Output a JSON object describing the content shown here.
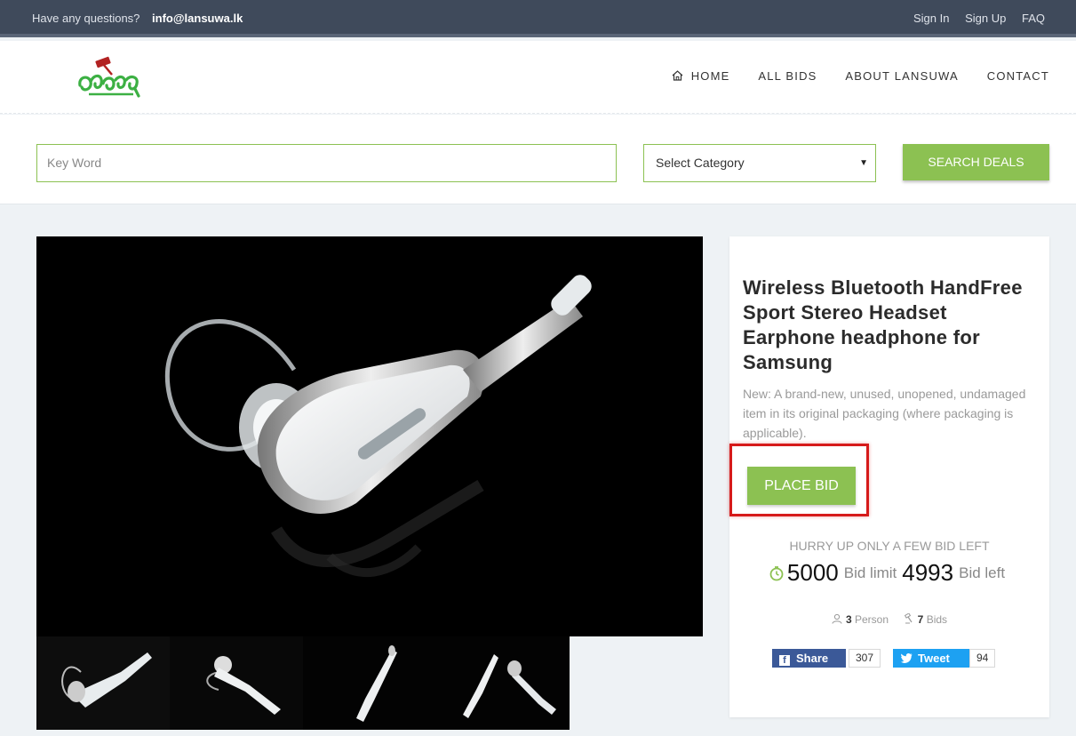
{
  "topbar": {
    "question": "Have any questions?",
    "email": "info@lansuwa.lk",
    "links": [
      "Sign In",
      "Sign Up",
      "FAQ"
    ]
  },
  "header": {
    "nav": {
      "home": "HOME",
      "all_bids": "ALL BIDS",
      "about": "ABOUT LANSUWA",
      "contact": "CONTACT"
    }
  },
  "search": {
    "keyword_placeholder": "Key Word",
    "category": "Select Category",
    "button": "SEARCH DEALS"
  },
  "product": {
    "title": "Wireless Bluetooth HandFree Sport Stereo Headset Earphone headphone for Samsung",
    "description": "New: A brand-new, unused, unopened, undamaged item in its original packaging (where packaging is applicable).",
    "place_bid": "PLACE BID",
    "hurry": "HURRY UP ONLY A FEW BID LEFT",
    "bid_limit_value": "5000",
    "bid_limit_label": "Bid limit",
    "bid_left_value": "4993",
    "bid_left_label": "Bid left",
    "persons": "3",
    "persons_label": "Person",
    "bids": "7",
    "bids_label": "Bids"
  },
  "social": {
    "share_label": "Share",
    "share_count": "307",
    "tweet_label": "Tweet",
    "tweet_count": "94"
  },
  "colors": {
    "accent": "#8cc152",
    "topbar": "#3f4a5b",
    "highlight": "#d61a1a",
    "facebook": "#3b5998",
    "twitter": "#1da1f2"
  }
}
